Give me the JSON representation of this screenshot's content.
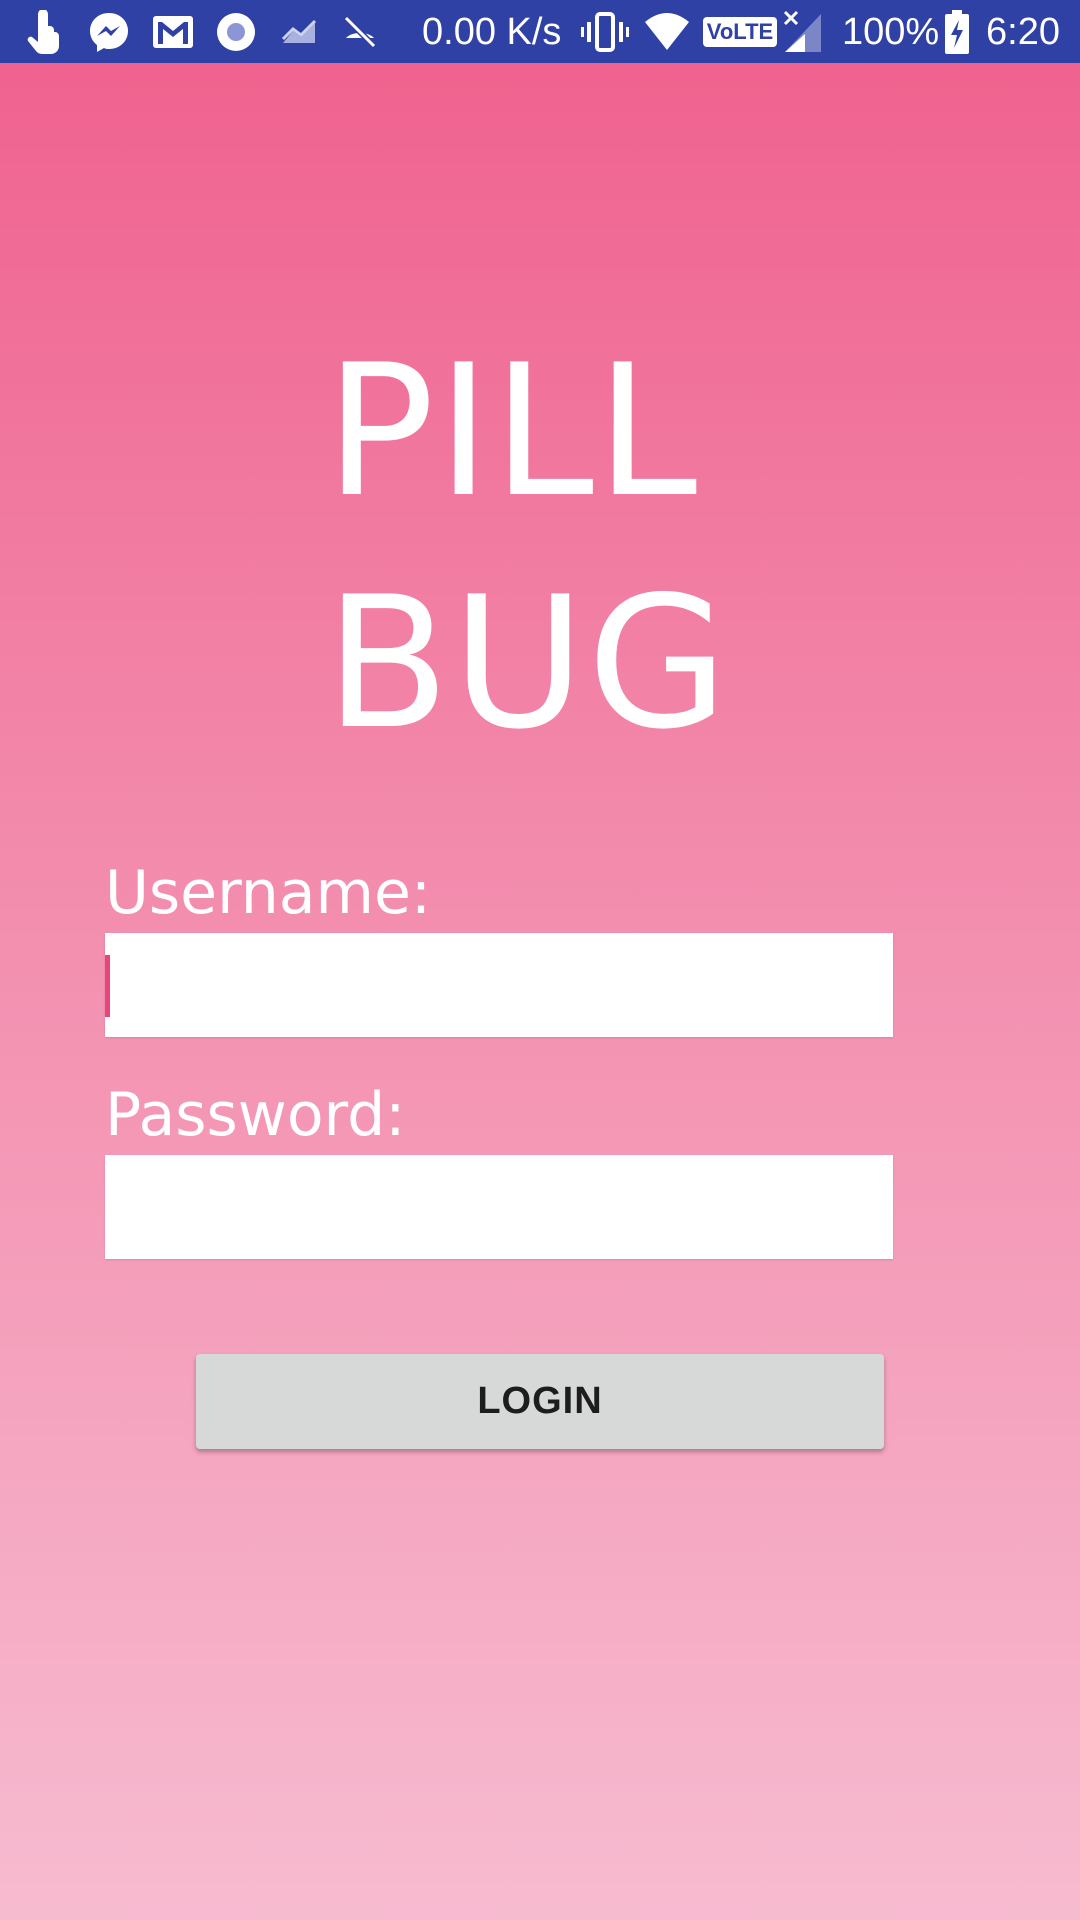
{
  "status_bar": {
    "background": "#3041a6",
    "icons_left": [
      "touch-icon",
      "messenger-icon",
      "gmail-icon",
      "record-icon",
      "chart-icon",
      "sync-disabled-icon"
    ],
    "net_speed": "0.00 K/s",
    "icons_right": [
      "vibrate-icon",
      "wifi-icon",
      "volte-icon",
      "signal-icon"
    ],
    "volte_label": "VoLTE",
    "battery": "100%",
    "time": "6:20"
  },
  "logo": {
    "line1": "PILL",
    "line2": "BUG"
  },
  "form": {
    "username_label": "Username:",
    "username_value": "",
    "password_label": "Password:",
    "password_value": "",
    "login_label": "LOGIN"
  },
  "colors": {
    "gradient_top": "#ef5f8d",
    "gradient_bottom": "#f7bbd0",
    "caret": "#e8457c",
    "button": "#d7d8d8"
  }
}
